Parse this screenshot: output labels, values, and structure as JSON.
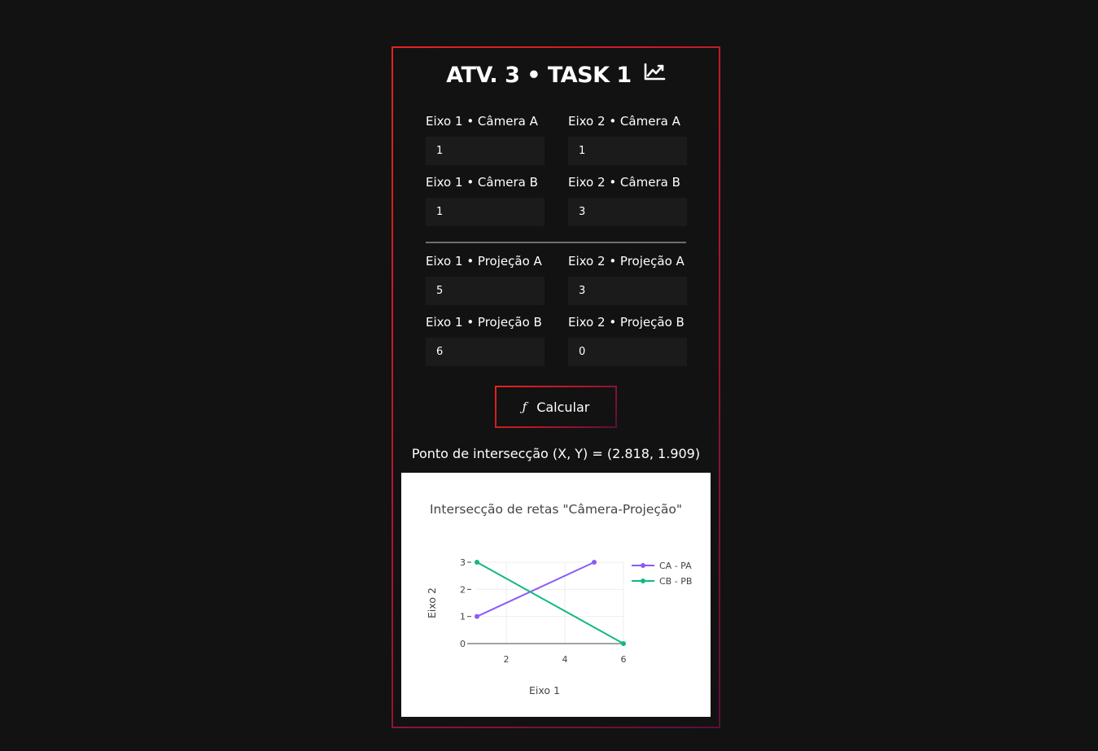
{
  "header": {
    "title": "ATV. 3 • TASK 1",
    "icon": "chart-line-icon"
  },
  "camera_fields": [
    {
      "label": "Eixo 1 • Câmera A",
      "value": "1"
    },
    {
      "label": "Eixo 2 • Câmera A",
      "value": "1"
    },
    {
      "label": "Eixo 1 • Câmera B",
      "value": "1"
    },
    {
      "label": "Eixo 2 • Câmera B",
      "value": "3"
    }
  ],
  "projection_fields": [
    {
      "label": "Eixo 1 • Projeção A",
      "value": "5"
    },
    {
      "label": "Eixo 2 • Projeção A",
      "value": "3"
    },
    {
      "label": "Eixo 1 • Projeção B",
      "value": "6"
    },
    {
      "label": "Eixo 2 • Projeção B",
      "value": "0"
    }
  ],
  "button": {
    "label": "Calcular",
    "icon": "function-icon"
  },
  "result": {
    "text": "Ponto de intersecção (X, Y) = (2.818, 1.909)"
  },
  "colors": {
    "accent_start": "#e5241c",
    "accent_end": "#5b0f3a",
    "background": "#121213",
    "input_bg": "#1b1b1c",
    "series_ca_pa": "#8b5cf6",
    "series_cb_pb": "#10b981"
  },
  "chart_data": {
    "type": "line",
    "title": "Intersecção de retas \"Câmera-Projeção\"",
    "xlabel": "Eixo 1",
    "ylabel": "Eixo 2",
    "xlim": [
      1,
      6
    ],
    "ylim": [
      0,
      3
    ],
    "xticks": [
      "2",
      "4",
      "6"
    ],
    "yticks": [
      "0",
      "1",
      "2",
      "3"
    ],
    "grid": true,
    "legend_position": "top-right",
    "series": [
      {
        "name": "CA - PA",
        "x": [
          1,
          5
        ],
        "y": [
          1,
          3
        ],
        "color": "#8b5cf6"
      },
      {
        "name": "CB - PB",
        "x": [
          1,
          6
        ],
        "y": [
          3,
          0
        ],
        "color": "#10b981"
      }
    ]
  }
}
